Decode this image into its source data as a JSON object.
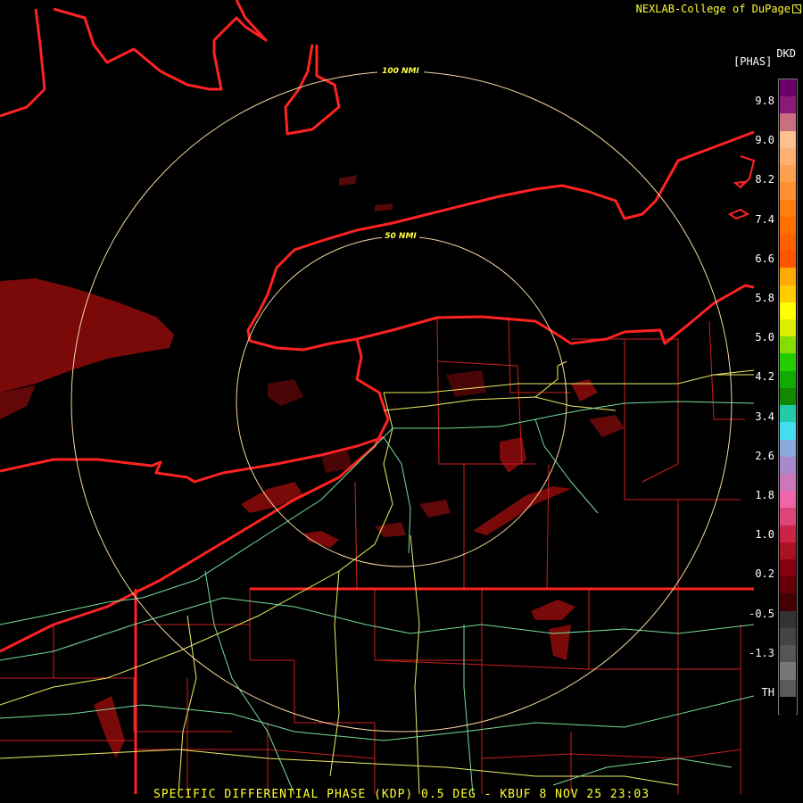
{
  "header": {
    "credit": "NEXLAB-College of DuPage",
    "credit_icon": "external-link-icon"
  },
  "legend": {
    "product_code": "DKD",
    "unit": "[PHAS]",
    "ticks": [
      "9.8",
      "9.0",
      "8.2",
      "7.4",
      "6.6",
      "5.8",
      "5.0",
      "4.2",
      "3.4",
      "2.6",
      "1.8",
      "1.0",
      "0.2",
      "-0.5",
      "-1.3",
      "TH"
    ],
    "colors": [
      "#6a006a",
      "#8a1a7a",
      "#c87080",
      "#ffc090",
      "#ffb070",
      "#ffa050",
      "#ff9030",
      "#ff8010",
      "#ff7000",
      "#ff6000",
      "#ff5500",
      "#ffaa00",
      "#ffcc00",
      "#ffff00",
      "#ddee00",
      "#88dd00",
      "#22cc00",
      "#11aa00",
      "#118800",
      "#22ccaa",
      "#44ddee",
      "#88aadd",
      "#aa88cc",
      "#cc77bb",
      "#ee66aa",
      "#dd4477",
      "#cc2244",
      "#aa1122",
      "#880010",
      "#660008",
      "#440000",
      "#333333",
      "#444444",
      "#555555",
      "#777777",
      "#5a5a5a",
      "#000000"
    ]
  },
  "map": {
    "rings": [
      {
        "label": "100 NMI"
      },
      {
        "label": "50 NMI"
      }
    ],
    "colors": {
      "ring": "#f5d7a0",
      "coast": "#ff2222",
      "county": "#cc2020",
      "highway_yellow": "#eeee66",
      "highway_green": "#77dd99",
      "echo": "#7a0a0a"
    }
  },
  "footer": {
    "title": "SPECIFIC DIFFERENTIAL PHASE (KDP) 0.5 DEG - KBUF 8 NOV 25 23:03"
  }
}
